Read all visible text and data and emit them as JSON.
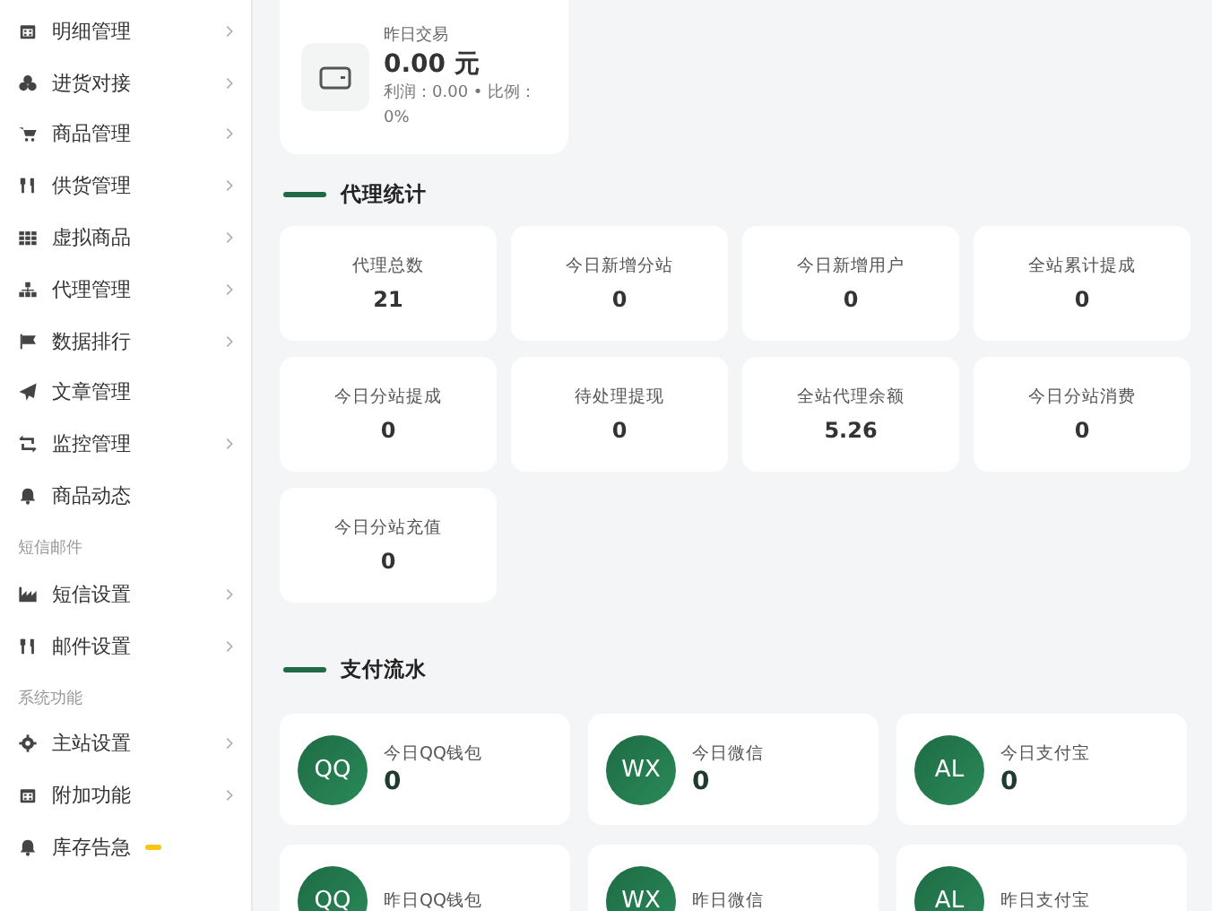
{
  "sidebar": {
    "groups": [
      {
        "items": [
          {
            "label": "明细管理",
            "has_arrow": true
          },
          {
            "label": "进货对接",
            "has_arrow": true
          },
          {
            "label": "商品管理",
            "has_arrow": true
          },
          {
            "label": "供货管理",
            "has_arrow": true
          },
          {
            "label": "虚拟商品",
            "has_arrow": true
          },
          {
            "label": "代理管理",
            "has_arrow": true
          },
          {
            "label": "数据排行",
            "has_arrow": true
          },
          {
            "label": "文章管理",
            "has_arrow": false
          },
          {
            "label": "监控管理",
            "has_arrow": true
          },
          {
            "label": "商品动态",
            "has_arrow": false
          }
        ]
      },
      {
        "heading": "短信邮件",
        "items": [
          {
            "label": "短信设置",
            "has_arrow": true
          },
          {
            "label": "邮件设置",
            "has_arrow": true
          }
        ]
      },
      {
        "heading": "系统功能",
        "items": [
          {
            "label": "主站设置",
            "has_arrow": true
          },
          {
            "label": "附加功能",
            "has_arrow": true
          },
          {
            "label": "库存告急",
            "has_arrow": false,
            "badge": true
          }
        ]
      }
    ]
  },
  "summary_card": {
    "label": "昨日交易",
    "amount": "0.00 元",
    "detail": "利润：0.00 • 比例：0%"
  },
  "agent_stats": {
    "title": "代理统计",
    "cards": [
      {
        "label": "代理总数",
        "value": "21"
      },
      {
        "label": "今日新增分站",
        "value": "0"
      },
      {
        "label": "今日新增用户",
        "value": "0"
      },
      {
        "label": "全站累计提成",
        "value": "0"
      },
      {
        "label": "今日分站提成",
        "value": "0"
      },
      {
        "label": "待处理提现",
        "value": "0"
      },
      {
        "label": "全站代理余额",
        "value": "5.26"
      },
      {
        "label": "今日分站消费",
        "value": "0"
      },
      {
        "label": "今日分站充值",
        "value": "0"
      }
    ]
  },
  "payment_flow": {
    "title": "支付流水",
    "cards": [
      {
        "avatar": "QQ",
        "label": "今日QQ钱包",
        "value": "0"
      },
      {
        "avatar": "WX",
        "label": "今日微信",
        "value": "0"
      },
      {
        "avatar": "AL",
        "label": "今日支付宝",
        "value": "0"
      },
      {
        "avatar": "QQ",
        "label": "昨日QQ钱包"
      },
      {
        "avatar": "WX",
        "label": "昨日微信"
      },
      {
        "avatar": "AL",
        "label": "昨日支付宝"
      }
    ]
  }
}
